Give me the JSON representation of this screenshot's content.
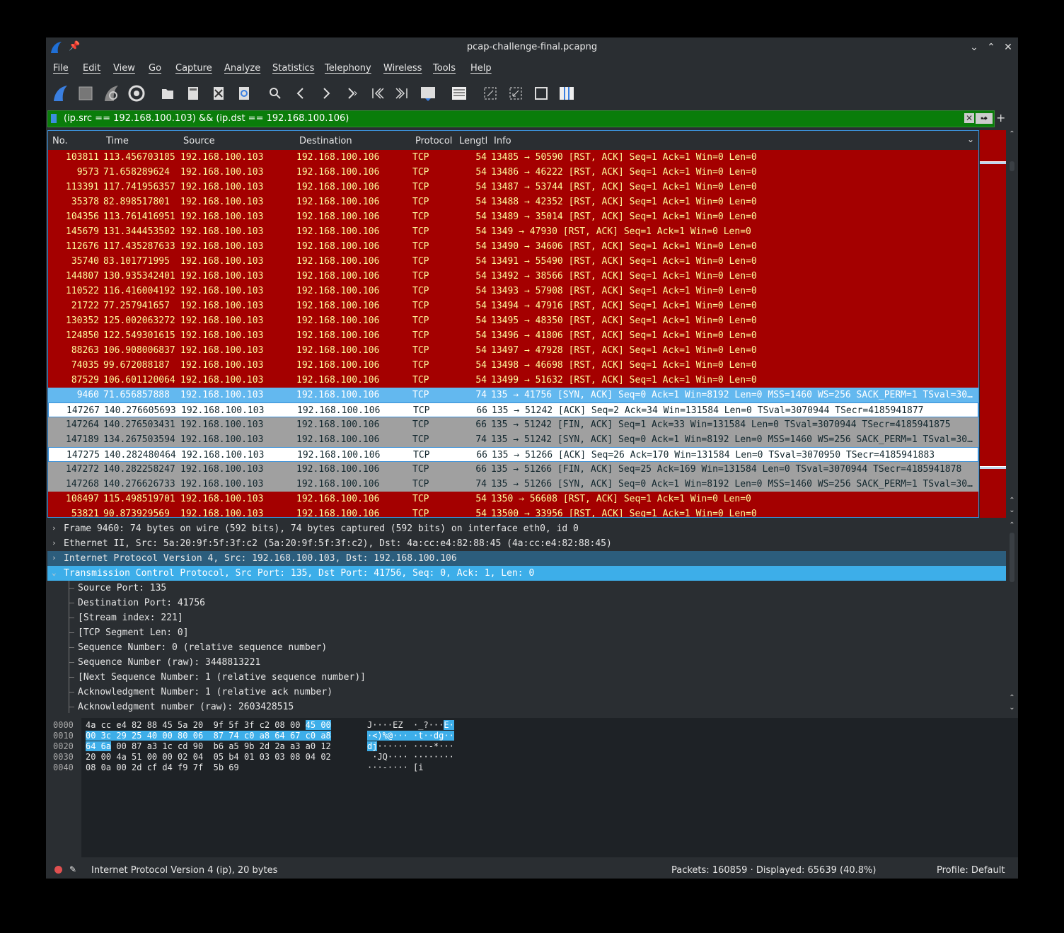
{
  "window": {
    "title": "pcap-challenge-final.pcapng"
  },
  "menu": [
    "File",
    "Edit",
    "View",
    "Go",
    "Capture",
    "Analyze",
    "Statistics",
    "Telephony",
    "Wireless",
    "Tools",
    "Help"
  ],
  "toolbar_icons": [
    "start-capture-icon",
    "stop-capture-icon",
    "restart-capture-icon",
    "capture-options-icon",
    "open-file-icon",
    "save-file-icon",
    "close-file-icon",
    "reload-file-icon",
    "find-packet-icon",
    "go-back-icon",
    "go-forward-icon",
    "go-to-packet-icon",
    "go-first-icon",
    "go-last-icon",
    "autoscroll-icon",
    "colorize-icon",
    "zoom-in-icon",
    "zoom-out-icon",
    "normal-size-icon",
    "resize-columns-icon"
  ],
  "filter": {
    "text": "(ip.src == 192.168.100.103) && (ip.dst == 192.168.100.106)",
    "clear": "✕",
    "apply": "➡",
    "dropdown": "▾",
    "plus": "+"
  },
  "columns": {
    "no": "No.",
    "time": "Time",
    "source": "Source",
    "destination": "Destination",
    "protocol": "Protocol",
    "length": "Lengtl",
    "info": "Info"
  },
  "packets": [
    {
      "no": "103811",
      "time": "113.456703185",
      "src": "192.168.100.103",
      "dst": "192.168.100.106",
      "proto": "TCP",
      "len": "54",
      "info": "13485 → 50590 [RST, ACK] Seq=1 Ack=1 Win=0 Len=0",
      "style": "rst"
    },
    {
      "no": "9573",
      "time": "71.658289624",
      "src": "192.168.100.103",
      "dst": "192.168.100.106",
      "proto": "TCP",
      "len": "54",
      "info": "13486 → 46222 [RST, ACK] Seq=1 Ack=1 Win=0 Len=0",
      "style": "rst"
    },
    {
      "no": "113391",
      "time": "117.741956357",
      "src": "192.168.100.103",
      "dst": "192.168.100.106",
      "proto": "TCP",
      "len": "54",
      "info": "13487 → 53744 [RST, ACK] Seq=1 Ack=1 Win=0 Len=0",
      "style": "rst"
    },
    {
      "no": "35378",
      "time": "82.898517801",
      "src": "192.168.100.103",
      "dst": "192.168.100.106",
      "proto": "TCP",
      "len": "54",
      "info": "13488 → 42352 [RST, ACK] Seq=1 Ack=1 Win=0 Len=0",
      "style": "rst"
    },
    {
      "no": "104356",
      "time": "113.761416951",
      "src": "192.168.100.103",
      "dst": "192.168.100.106",
      "proto": "TCP",
      "len": "54",
      "info": "13489 → 35014 [RST, ACK] Seq=1 Ack=1 Win=0 Len=0",
      "style": "rst"
    },
    {
      "no": "145679",
      "time": "131.344453502",
      "src": "192.168.100.103",
      "dst": "192.168.100.106",
      "proto": "TCP",
      "len": "54",
      "info": "1349 → 47930 [RST, ACK] Seq=1 Ack=1 Win=0 Len=0",
      "style": "rst"
    },
    {
      "no": "112676",
      "time": "117.435287633",
      "src": "192.168.100.103",
      "dst": "192.168.100.106",
      "proto": "TCP",
      "len": "54",
      "info": "13490 → 34606 [RST, ACK] Seq=1 Ack=1 Win=0 Len=0",
      "style": "rst"
    },
    {
      "no": "35740",
      "time": "83.101771995",
      "src": "192.168.100.103",
      "dst": "192.168.100.106",
      "proto": "TCP",
      "len": "54",
      "info": "13491 → 55490 [RST, ACK] Seq=1 Ack=1 Win=0 Len=0",
      "style": "rst"
    },
    {
      "no": "144807",
      "time": "130.935342401",
      "src": "192.168.100.103",
      "dst": "192.168.100.106",
      "proto": "TCP",
      "len": "54",
      "info": "13492 → 38566 [RST, ACK] Seq=1 Ack=1 Win=0 Len=0",
      "style": "rst"
    },
    {
      "no": "110522",
      "time": "116.416004192",
      "src": "192.168.100.103",
      "dst": "192.168.100.106",
      "proto": "TCP",
      "len": "54",
      "info": "13493 → 57908 [RST, ACK] Seq=1 Ack=1 Win=0 Len=0",
      "style": "rst"
    },
    {
      "no": "21722",
      "time": "77.257941657",
      "src": "192.168.100.103",
      "dst": "192.168.100.106",
      "proto": "TCP",
      "len": "54",
      "info": "13494 → 47916 [RST, ACK] Seq=1 Ack=1 Win=0 Len=0",
      "style": "rst"
    },
    {
      "no": "130352",
      "time": "125.002063272",
      "src": "192.168.100.103",
      "dst": "192.168.100.106",
      "proto": "TCP",
      "len": "54",
      "info": "13495 → 48350 [RST, ACK] Seq=1 Ack=1 Win=0 Len=0",
      "style": "rst"
    },
    {
      "no": "124850",
      "time": "122.549301615",
      "src": "192.168.100.103",
      "dst": "192.168.100.106",
      "proto": "TCP",
      "len": "54",
      "info": "13496 → 41806 [RST, ACK] Seq=1 Ack=1 Win=0 Len=0",
      "style": "rst"
    },
    {
      "no": "88263",
      "time": "106.908006837",
      "src": "192.168.100.103",
      "dst": "192.168.100.106",
      "proto": "TCP",
      "len": "54",
      "info": "13497 → 47928 [RST, ACK] Seq=1 Ack=1 Win=0 Len=0",
      "style": "rst"
    },
    {
      "no": "74035",
      "time": "99.672088187",
      "src": "192.168.100.103",
      "dst": "192.168.100.106",
      "proto": "TCP",
      "len": "54",
      "info": "13498 → 46698 [RST, ACK] Seq=1 Ack=1 Win=0 Len=0",
      "style": "rst"
    },
    {
      "no": "87529",
      "time": "106.601120064",
      "src": "192.168.100.103",
      "dst": "192.168.100.106",
      "proto": "TCP",
      "len": "54",
      "info": "13499 → 51632 [RST, ACK] Seq=1 Ack=1 Win=0 Len=0",
      "style": "rst"
    },
    {
      "no": "9460",
      "time": "71.656857888",
      "src": "192.168.100.103",
      "dst": "192.168.100.106",
      "proto": "TCP",
      "len": "74",
      "info": "135 → 41756 [SYN, ACK] Seq=0 Ack=1 Win=8192 Len=0 MSS=1460 WS=256 SACK_PERM=1 TSval=30…",
      "style": "sel"
    },
    {
      "no": "147267",
      "time": "140.276605693",
      "src": "192.168.100.103",
      "dst": "192.168.100.106",
      "proto": "TCP",
      "len": "66",
      "info": "135 → 51242 [ACK] Seq=2 Ack=34 Win=131584 Len=0 TSval=3070944 TSecr=4185941877",
      "style": "white"
    },
    {
      "no": "147264",
      "time": "140.276503431",
      "src": "192.168.100.103",
      "dst": "192.168.100.106",
      "proto": "TCP",
      "len": "66",
      "info": "135 → 51242 [FIN, ACK] Seq=1 Ack=33 Win=131584 Len=0 TSval=3070944 TSecr=4185941875",
      "style": "grey"
    },
    {
      "no": "147189",
      "time": "134.267503594",
      "src": "192.168.100.103",
      "dst": "192.168.100.106",
      "proto": "TCP",
      "len": "74",
      "info": "135 → 51242 [SYN, ACK] Seq=0 Ack=1 Win=8192 Len=0 MSS=1460 WS=256 SACK_PERM=1 TSval=30…",
      "style": "grey"
    },
    {
      "no": "147275",
      "time": "140.282480464",
      "src": "192.168.100.103",
      "dst": "192.168.100.106",
      "proto": "TCP",
      "len": "66",
      "info": "135 → 51266 [ACK] Seq=26 Ack=170 Win=131584 Len=0 TSval=3070950 TSecr=4185941883",
      "style": "white"
    },
    {
      "no": "147272",
      "time": "140.282258247",
      "src": "192.168.100.103",
      "dst": "192.168.100.106",
      "proto": "TCP",
      "len": "66",
      "info": "135 → 51266 [FIN, ACK] Seq=25 Ack=169 Win=131584 Len=0 TSval=3070944 TSecr=4185941878",
      "style": "grey"
    },
    {
      "no": "147268",
      "time": "140.276626733",
      "src": "192.168.100.103",
      "dst": "192.168.100.106",
      "proto": "TCP",
      "len": "74",
      "info": "135 → 51266 [SYN, ACK] Seq=0 Ack=1 Win=8192 Len=0 MSS=1460 WS=256 SACK_PERM=1 TSval=30…",
      "style": "grey"
    },
    {
      "no": "108497",
      "time": "115.498519701",
      "src": "192.168.100.103",
      "dst": "192.168.100.106",
      "proto": "TCP",
      "len": "54",
      "info": "1350 → 56608 [RST, ACK] Seq=1 Ack=1 Win=0 Len=0",
      "style": "rst"
    },
    {
      "no": "53821",
      "time": "90.873929569",
      "src": "192.168.100.103",
      "dst": "192.168.100.106",
      "proto": "TCP",
      "len": "54",
      "info": "13500 → 33956 [RST, ACK] Seq=1 Ack=1 Win=0 Len=0",
      "style": "rst"
    }
  ],
  "details": [
    {
      "text": "Frame 9460: 74 bytes on wire (592 bits), 74 bytes captured (592 bits) on interface eth0, id 0",
      "exp": "›",
      "style": ""
    },
    {
      "text": "Ethernet II, Src: 5a:20:9f:5f:3f:c2 (5a:20:9f:5f:3f:c2), Dst: 4a:cc:e4:82:88:45 (4a:cc:e4:82:88:45)",
      "exp": "›",
      "style": ""
    },
    {
      "text": "Internet Protocol Version 4, Src: 192.168.100.103, Dst: 192.168.100.106",
      "exp": "›",
      "style": "hl"
    },
    {
      "text": "Transmission Control Protocol, Src Port: 135, Dst Port: 41756, Seq: 0, Ack: 1, Len: 0",
      "exp": "⌄",
      "style": "hl2"
    },
    {
      "text": "Source Port: 135",
      "exp": "",
      "style": "child"
    },
    {
      "text": "Destination Port: 41756",
      "exp": "",
      "style": "child"
    },
    {
      "text": "[Stream index: 221]",
      "exp": "",
      "style": "child"
    },
    {
      "text": "[TCP Segment Len: 0]",
      "exp": "",
      "style": "child"
    },
    {
      "text": "Sequence Number: 0    (relative sequence number)",
      "exp": "",
      "style": "child"
    },
    {
      "text": "Sequence Number (raw): 3448813221",
      "exp": "",
      "style": "child"
    },
    {
      "text": "[Next Sequence Number: 1    (relative sequence number)]",
      "exp": "",
      "style": "child"
    },
    {
      "text": "Acknowledgment Number: 1    (relative ack number)",
      "exp": "",
      "style": "child"
    },
    {
      "text": "Acknowledgment number (raw): 2603428515",
      "exp": "",
      "style": "child"
    }
  ],
  "hex": [
    {
      "off": "0000",
      "bytes": "4a cc e4 82 88 45 5a 20  9f 5f 3f c2 08 00 ",
      "bsel": "45 00",
      "ascii": "J····EZ  ·_?···",
      "asel": "E·",
      "asc2": ""
    },
    {
      "off": "0010",
      "bytes": "",
      "bsel": "00 3c 29 25 40 00 80 06  87 74 c0 a8 64 67 c0 a8",
      "ascii": "",
      "asel": "·<)%@··· ·t··dg··",
      "asc2": ""
    },
    {
      "off": "0020",
      "bytes": " 00 87 a3 1c cd 90  b6 a5 9b 2d 2a a3 a0 12",
      "bsel": "64 6a",
      "ascii": "······ ···-*···",
      "asel": "dj",
      "asc2": ""
    },
    {
      "off": "0030",
      "bytes": "20 00 4a 51 00 00 02 04  05 b4 01 03 03 08 04 02",
      "bsel": "",
      "ascii": " ·JQ···· ········",
      "asel": "",
      "asc2": ""
    },
    {
      "off": "0040",
      "bytes": "08 0a 00 2d cf d4 f9 7f  5b 69",
      "bsel": "",
      "ascii": "···-···· [i",
      "asel": "",
      "asc2": ""
    }
  ],
  "status": {
    "message": "Internet Protocol Version 4 (ip), 20 bytes",
    "packets": "Packets: 160859 · Displayed: 65639 (40.8%)",
    "profile": "Profile: Default"
  }
}
